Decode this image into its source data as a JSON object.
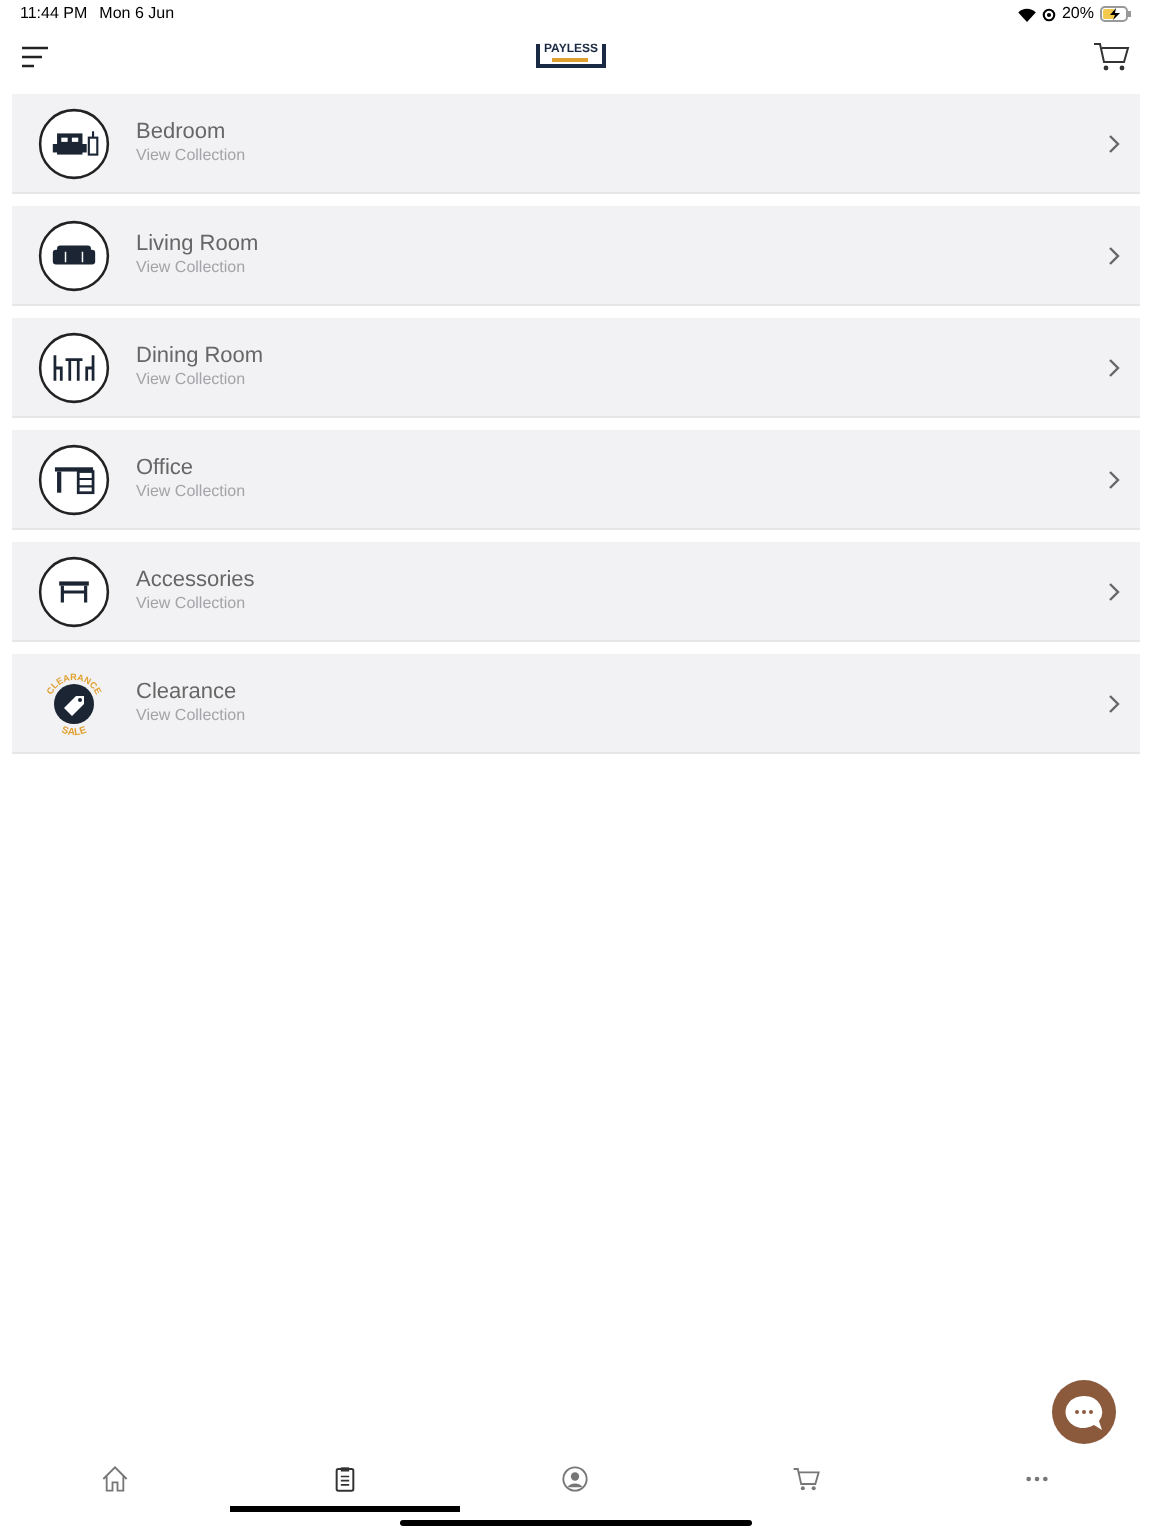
{
  "status_bar": {
    "time": "11:44 PM",
    "date": "Mon 6 Jun",
    "battery": "20%"
  },
  "header": {
    "logo": "PAYLESS"
  },
  "categories": [
    {
      "title": "Bedroom",
      "subtitle": "View Collection",
      "kind": "bed"
    },
    {
      "title": "Living Room",
      "subtitle": "View Collection",
      "kind": "sofa"
    },
    {
      "title": "Dining Room",
      "subtitle": "View Collection",
      "kind": "dining"
    },
    {
      "title": "Office",
      "subtitle": "View Collection",
      "kind": "desk"
    },
    {
      "title": "Accessories",
      "subtitle": "View Collection",
      "kind": "table"
    },
    {
      "title": "Clearance",
      "subtitle": "View Collection",
      "kind": "clearance",
      "badge_top": "CLEARANCE",
      "badge_bottom": "SALE"
    }
  ],
  "tab_bar": [
    {
      "kind": "home",
      "selected": false
    },
    {
      "kind": "clipboard",
      "selected": true
    },
    {
      "kind": "account",
      "selected": false
    },
    {
      "kind": "cart",
      "selected": false
    },
    {
      "kind": "more",
      "selected": false
    }
  ]
}
